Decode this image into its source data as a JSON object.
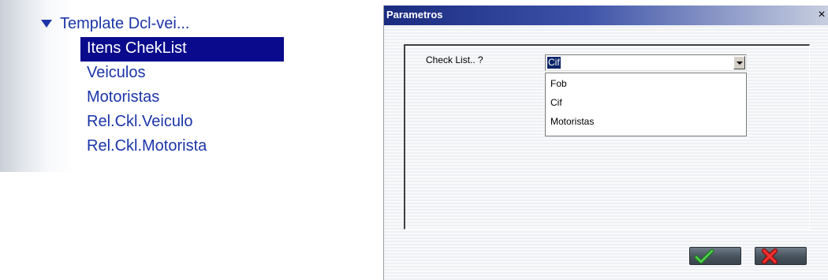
{
  "tree": {
    "root_label": "Template Dcl-vei...",
    "items": [
      {
        "label": "Itens ChekList",
        "selected": true
      },
      {
        "label": "Veiculos",
        "selected": false
      },
      {
        "label": "Motoristas",
        "selected": false
      },
      {
        "label": "Rel.Ckl.Veiculo",
        "selected": false
      },
      {
        "label": "Rel.Ckl.Motorista",
        "selected": false
      }
    ]
  },
  "dialog": {
    "title": "Parametros",
    "close_label": "×",
    "field_label": "Check List.. ?",
    "select_value": "Cif",
    "options": [
      "Fob",
      "Cif",
      "Motoristas"
    ],
    "ok_icon": "checkmark-icon",
    "cancel_icon": "x-icon"
  },
  "colors": {
    "tree_text": "#1b35a8",
    "selection": "#0a0a8c",
    "titlebar": "#1a2c80",
    "check_green": "#2fa32f",
    "cancel_red": "#e02020"
  }
}
